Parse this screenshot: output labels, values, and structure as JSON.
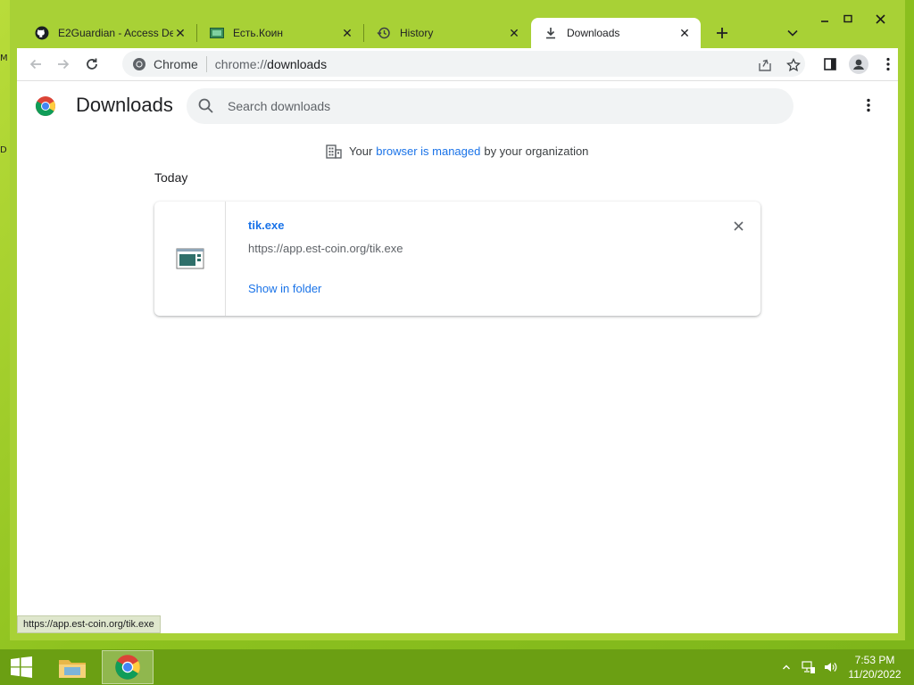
{
  "tabs": [
    {
      "title": "E2Guardian - Access De",
      "icon": "github-icon"
    },
    {
      "title": "Есть.Коин",
      "icon": "coin-site-icon"
    },
    {
      "title": "History",
      "icon": "history-icon"
    },
    {
      "title": "Downloads",
      "icon": "download-icon",
      "active": true
    }
  ],
  "omnibox": {
    "chip": "Chrome",
    "scheme": "chrome://",
    "host": "downloads"
  },
  "page": {
    "title": "Downloads",
    "search_placeholder": "Search downloads",
    "managed_prefix": "Your",
    "managed_link": "browser is managed",
    "managed_suffix": "by your organization",
    "section_date": "Today"
  },
  "download": {
    "file_name": "tik.exe",
    "url": "https://app.est-coin.org/tik.exe",
    "action": "Show in folder"
  },
  "status_bar": "https://app.est-coin.org/tik.exe",
  "clock": {
    "time": "7:53 PM",
    "date": "11/20/2022"
  },
  "colors": {
    "accent": "#1a73e8",
    "frame": "#a8d136",
    "taskbar": "#6b9f13"
  }
}
